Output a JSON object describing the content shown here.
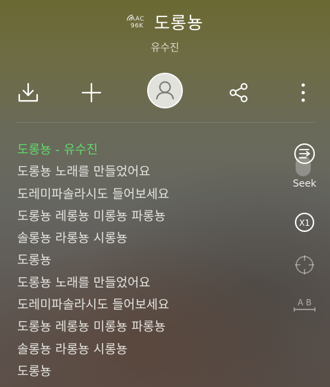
{
  "header": {
    "codec_line1": "AAC",
    "codec_line2": "96K",
    "title": "도롱뇽",
    "artist": "유수진"
  },
  "toolbar": {
    "icons": [
      "download-icon",
      "plus-icon",
      "avatar-icon",
      "share-icon",
      "more-vertical-icon"
    ]
  },
  "lyrics": {
    "lines": [
      "도롱뇽 - 유수진",
      "도롱뇽 노래를 만들었어요",
      "도레미파솔라시도 들어보세요",
      "도롱뇽 레롱뇽 미롱뇽 파롱뇽",
      "솔롱뇽 라롱뇽 시롱뇽",
      "도롱뇽",
      "도롱뇽 노래를 만들었어요",
      "도레미파솔라시도 들어보세요",
      "도롱뇽 레롱뇽 미롱뇽 파롱뇽",
      "솔롱뇽 라롱뇽 시롱뇽",
      "도롱뇽"
    ],
    "active_index": 0,
    "active_color": "#62d86a"
  },
  "side_controls": {
    "seek_label": "Seek",
    "speed_label": "X1",
    "ab_label": "A B"
  }
}
